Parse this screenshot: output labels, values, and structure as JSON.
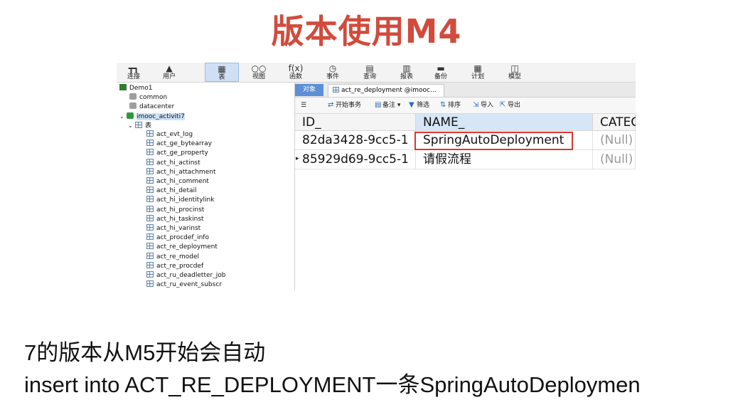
{
  "slide": {
    "title": "版本使用M4",
    "caption_line1": "7的版本从M5开始会自动",
    "caption_line2": "insert into ACT_RE_DEPLOYMENT一条SpringAutoDeploymen"
  },
  "toolbar": {
    "items": [
      {
        "label": "连接",
        "icon": "connection-icon"
      },
      {
        "label": "用户",
        "icon": "user-icon"
      },
      {
        "label": "表",
        "icon": "table-icon"
      },
      {
        "label": "视图",
        "icon": "view-icon"
      },
      {
        "label": "函数",
        "icon": "function-icon"
      },
      {
        "label": "事件",
        "icon": "event-icon"
      },
      {
        "label": "查询",
        "icon": "query-icon"
      },
      {
        "label": "报表",
        "icon": "report-icon"
      },
      {
        "label": "备份",
        "icon": "backup-icon"
      },
      {
        "label": "计划",
        "icon": "schedule-icon"
      },
      {
        "label": "模型",
        "icon": "model-icon"
      }
    ],
    "function_glyph": "f(x)"
  },
  "tree": {
    "connection": "Demo1",
    "databases": [
      "common",
      "datacenter"
    ],
    "active_db": "imooc_activiti7",
    "tables_node": "表",
    "tables": [
      "act_evt_log",
      "act_ge_bytearray",
      "act_ge_property",
      "act_hi_actinst",
      "act_hi_attachment",
      "act_hi_comment",
      "act_hi_detail",
      "act_hi_identitylink",
      "act_hi_procinst",
      "act_hi_taskinst",
      "act_hi_varinst",
      "act_procdef_info",
      "act_re_deployment",
      "act_re_model",
      "act_re_procdef",
      "act_ru_deadletter_job",
      "act_ru_event_subscr"
    ]
  },
  "tabs": {
    "objects": "对象",
    "document": "act_re_deployment @imooc..."
  },
  "subtoolbar": {
    "menu_glyph": "☰",
    "begin_tx": "开始事务",
    "note": "备注",
    "filter": "筛选",
    "sort": "排序",
    "import": "导入",
    "export": "导出"
  },
  "grid": {
    "columns": [
      "ID_",
      "NAME_",
      "CATEG"
    ],
    "rows": [
      [
        "82da3428-9cc5-1",
        "SpringAutoDeployment",
        "(Null)"
      ],
      [
        "85929d69-9cc5-1",
        "请假流程",
        "(Null)"
      ]
    ],
    "current_row_marker": "▸"
  }
}
